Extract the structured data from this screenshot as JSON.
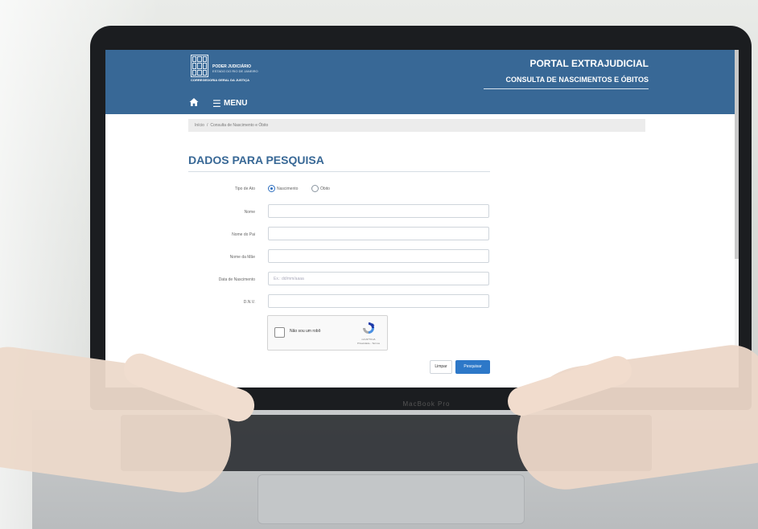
{
  "header": {
    "org_line1": "PODER JUDICIÁRIO",
    "org_line2": "ESTADO DO RIO DE JANEIRO",
    "org_line3": "CORREGEDORIA GERAL DA JUSTIÇA",
    "portal_title": "PORTAL EXTRAJUDICIAL",
    "portal_subtitle": "CONSULTA DE NASCIMENTOS E ÓBITOS",
    "menu_label": "MENU",
    "colors": {
      "primary": "#386896",
      "button": "#2d78c8"
    }
  },
  "breadcrumb": {
    "home": "Início",
    "separator": "/",
    "current": "Consulta de Nascimento e Óbito"
  },
  "form": {
    "title": "DADOS PARA PESQUISA",
    "act_type_label": "Tipo de Ato",
    "act_type_options": [
      "Nascimento",
      "Óbito"
    ],
    "act_type_selected": "Nascimento",
    "name_label": "Nome",
    "father_label": "Nome do Pai",
    "mother_label": "Nome da Mãe",
    "birth_date_label": "Data de Nascimento",
    "birth_date_placeholder": "Ex.: dd/mm/aaaa",
    "dnv_label": "D.N.V.",
    "captcha_text": "Não sou um robô",
    "captcha_brand": "reCAPTCHA",
    "captcha_links": "Privacidade - Termos",
    "clear_button": "Limpar",
    "search_button": "Pesquisar"
  },
  "laptop": {
    "bezel_label": "MacBook Pro"
  }
}
